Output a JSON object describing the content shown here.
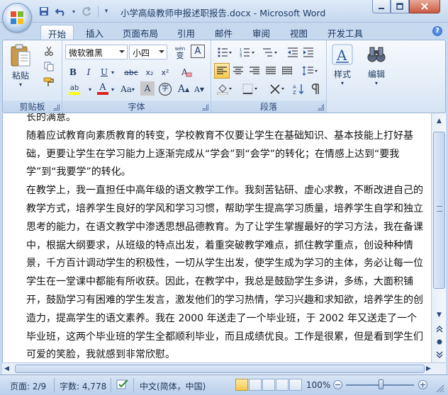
{
  "window": {
    "title": "小学高级教师申报述职报告.docx - Microsoft Word"
  },
  "quick_access": [
    {
      "name": "save-icon",
      "glyph": "💾"
    },
    {
      "name": "undo-icon",
      "glyph": "↶"
    },
    {
      "name": "redo-icon",
      "glyph": "↷"
    },
    {
      "name": "customize-qat-icon",
      "glyph": "▾"
    }
  ],
  "tabs": [
    "开始",
    "插入",
    "页面布局",
    "引用",
    "邮件",
    "审阅",
    "视图",
    "开发工具"
  ],
  "ribbon": {
    "clipboard": {
      "label": "剪贴板",
      "paste": "粘贴"
    },
    "font": {
      "label": "字体",
      "font_name": "微软雅黑",
      "font_size": "小四",
      "wen_glyph": "wén",
      "wen_char": "变",
      "border_char": "A",
      "bold": "B",
      "italic": "I",
      "underline": "U",
      "strike": "abc",
      "subscript": "x₂",
      "superscript": "x²",
      "highlight": "ab",
      "font_color": "A",
      "change_case": "Aa",
      "shade_char": "A",
      "enclose_char": "字",
      "grow": "A",
      "shrink": "A"
    },
    "paragraph": {
      "label": "段落"
    },
    "styles": {
      "label": "样式",
      "glyph": "A"
    },
    "editing": {
      "label": "编辑",
      "glyph": "A"
    }
  },
  "document": {
    "paragraphs": [
      "长的满意。",
      "随着应试教育向素质教育的转变，学校教育不仅要让学生在基础知识、基本技能上打好基础，更要让学生在学习能力上逐渐完成从“学会”到“会学”的转化；在情感上达到“要我学”到“我要学”的转化。",
      "在教学上，我一直担任中高年级的语文教学工作。我刻苦钻研、虚心求教，不断改进自己的教学方式，培养学生良好的学风和学习习惯，帮助学生提高学习质量，培养学生自学和独立思考的能力，在语文教学中渗透思想品德教育。为了让学生掌握最好的学习方法，我在备课中，根据大纲要求，从班级的特点出发，着重突破教学难点，抓住教学重点，创设种种情景，千方百计调动学生的积极性，一切从学生出发，使学生成为学习的主体，务必让每一位学生在一堂课中都能有所收获。因此，在教学中，我总是鼓励学生多讲，多练，大面积铺开，鼓励学习有困难的学生发言，激发他们的学习热情，学习兴趣和求知欲，培养学生的创造力，提高学生的语文素养。我在 2000 年送走了一个毕业班，于 2002 年又送走了一个毕业班，这两个毕业班的学生全都顺利毕业，而且成绩优良。工作是很累，但是看到学生们可爱的笑脸，我就感到非常欣慰。"
    ]
  },
  "status_bar": {
    "page": "页面: 2/9",
    "words": "字数: 4,778",
    "language": "中文(简体，中国)",
    "zoom": "100%",
    "zoom_minus": "−",
    "zoom_plus": "+"
  },
  "colors": {
    "highlight_yellow": "#ffff00",
    "font_color_red": "#e02020",
    "active_view": "#f7c94a"
  }
}
